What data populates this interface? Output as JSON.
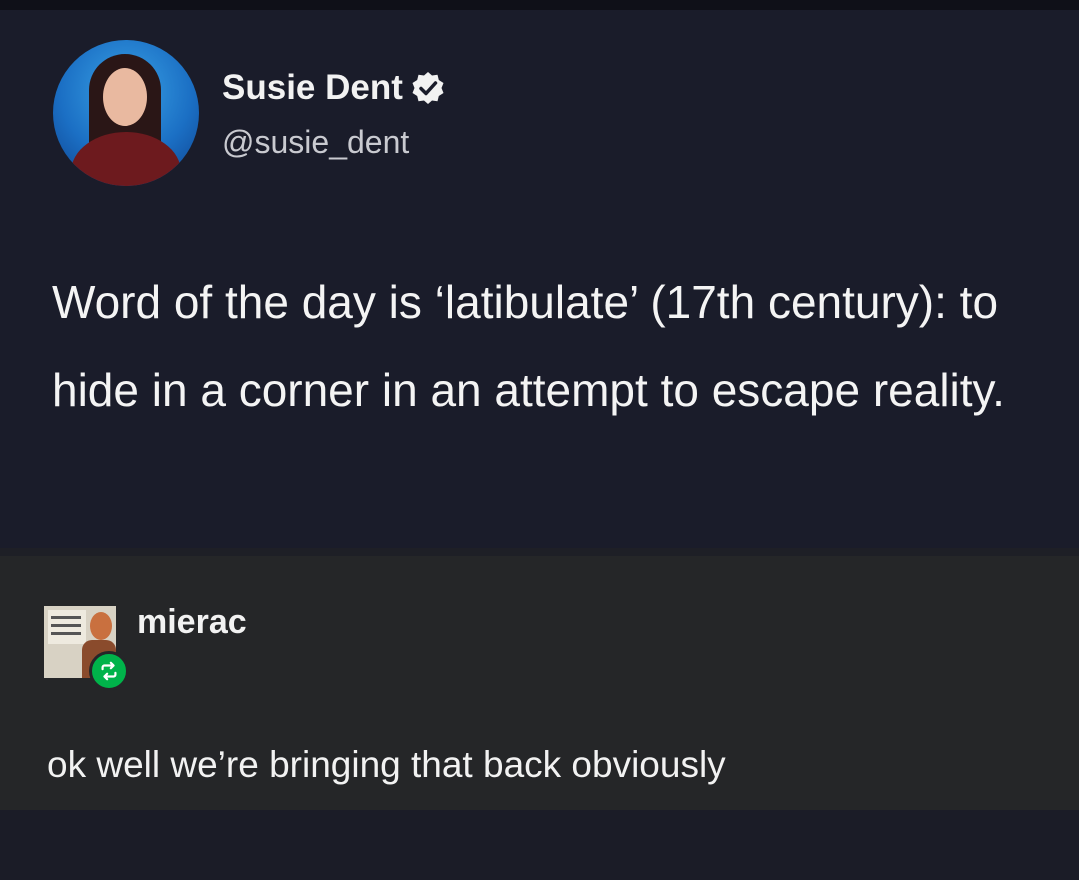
{
  "tweet": {
    "display_name": "Susie Dent",
    "handle": "@susie_dent",
    "text": "Word of the day is ‘latibulate’ (17th century): to hide in a corner in an attempt to escape reality.",
    "verified_icon": "verified-badge-icon"
  },
  "reblog": {
    "username": "mierac",
    "text": "ok well we’re bringing that back obviously",
    "badge_icon": "reblog-icon",
    "badge_color": "#00b34a"
  }
}
